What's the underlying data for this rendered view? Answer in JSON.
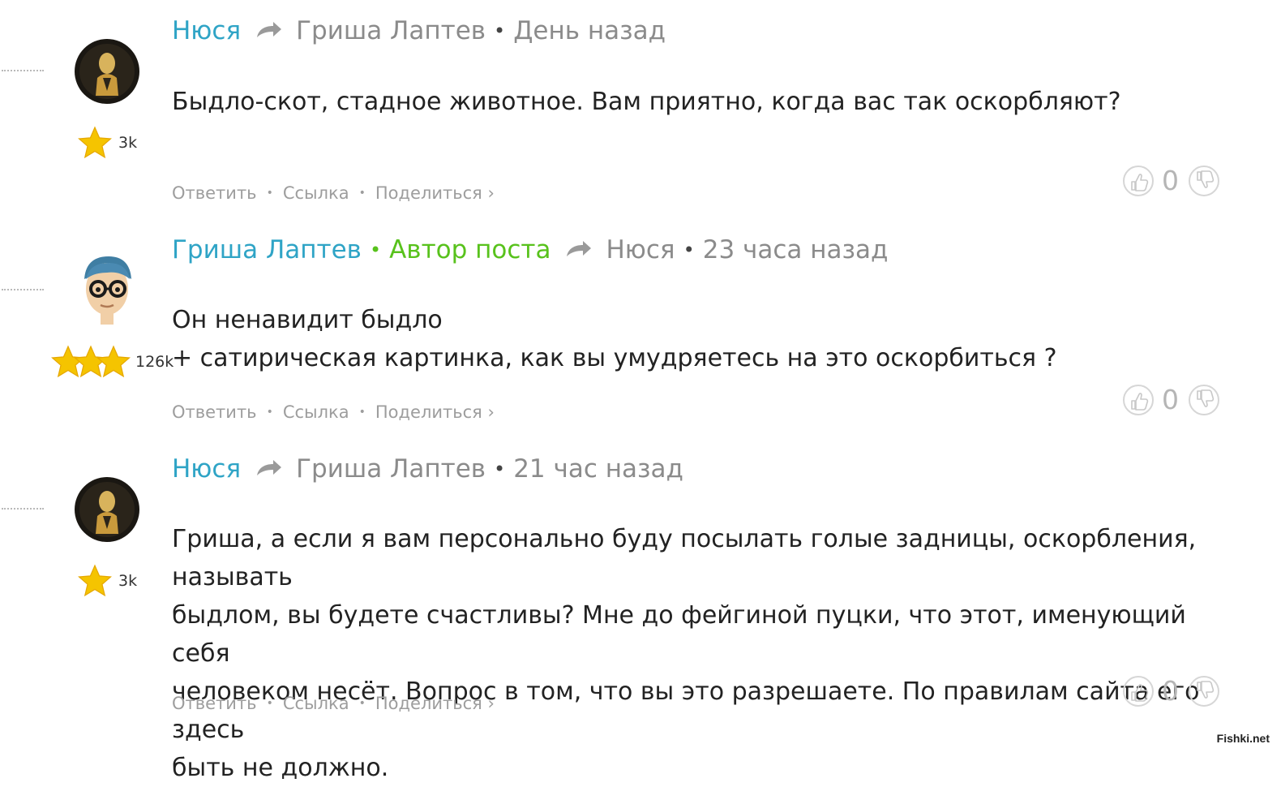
{
  "comments": [
    {
      "author": "Нюся",
      "author_badge": "",
      "reply_to": "Гриша Лаптев",
      "time": "День назад",
      "lines": [
        "Быдло-скот, стадное животное. Вам приятно, когда вас так оскорбляют?"
      ],
      "rating": "3k",
      "stars": 1,
      "avatar": "dark-silhouette",
      "score": "0"
    },
    {
      "author": "Гриша Лаптев",
      "author_badge": "Автор поста",
      "reply_to": "Нюся",
      "time": "23 часа назад",
      "lines": [
        "Он ненавидит быдло",
        "+ сатирическая картинка, как вы умудряетесь на это оскорбиться ?"
      ],
      "rating": "126k",
      "stars": 3,
      "avatar": "glasses-man",
      "score": "0"
    },
    {
      "author": "Нюся",
      "author_badge": "",
      "reply_to": "Гриша Лаптев",
      "time": "21 час назад",
      "lines": [
        "Гриша, а если я вам персонально буду посылать голые задницы, оскорбления, называть",
        "быдлом, вы будете счастливы? Мне до фейгиной пуцки, что этот, именующий себя",
        "человеком несёт. Вопрос в том, что вы это разрешаете. По правилам сайта его здесь",
        "быть не должно."
      ],
      "rating": "3k",
      "stars": 1,
      "avatar": "dark-silhouette",
      "score": "0"
    }
  ],
  "actions": {
    "reply": "Ответить",
    "link": "Ссылка",
    "share": "Поделиться ›"
  },
  "watermark": "Fishki.net",
  "colors": {
    "author": "#2fa4c6",
    "badge": "#58c21c",
    "meta": "#8b8b8b",
    "star": "#f5c400"
  },
  "icons": {
    "reply": "reply-arrow-icon",
    "like": "thumbs-up-icon",
    "dislike": "thumbs-down-icon",
    "rating": "star-icon"
  }
}
